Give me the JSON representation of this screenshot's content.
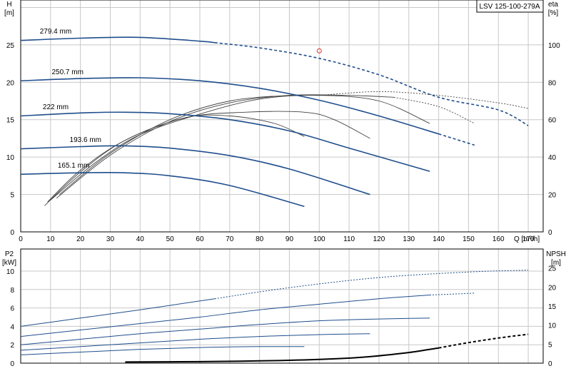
{
  "model_label": "LSV 125-100-279A",
  "chart_data": [
    {
      "type": "line",
      "panel": "head-efficiency",
      "x_unit": "Q [m³/h]",
      "xlim": [
        0,
        175
      ],
      "x_ticks": [
        0,
        10,
        20,
        30,
        40,
        50,
        60,
        70,
        80,
        90,
        100,
        110,
        120,
        130,
        140,
        150,
        160,
        170
      ],
      "left_axis": {
        "label": "H",
        "unit": "[m]",
        "lim": [
          0,
          31
        ],
        "ticks": [
          0,
          5,
          10,
          15,
          20,
          25
        ]
      },
      "right_axis": {
        "label": "eta",
        "unit": "[%]",
        "lim": [
          0,
          124
        ],
        "ticks": [
          0,
          20,
          40,
          60,
          80,
          100
        ]
      },
      "grid": true,
      "duty_point": {
        "x": 100,
        "y": 24.2
      },
      "head_curves": [
        {
          "name": "279.4 mm",
          "style": "solid",
          "points": [
            [
              0,
              25.6
            ],
            [
              20,
              25.9
            ],
            [
              40,
              26.0
            ],
            [
              60,
              25.5
            ],
            [
              65,
              25.3
            ]
          ]
        },
        {
          "name": "279.4 mm",
          "style": "dashed",
          "points": [
            [
              65,
              25.3
            ],
            [
              80,
              24.6
            ],
            [
              100,
              23.2
            ],
            [
              120,
              21.0
            ],
            [
              140,
              18.0
            ],
            [
              160,
              16.3
            ],
            [
              170,
              14.2
            ]
          ]
        },
        {
          "name": "250.7 mm",
          "style": "solid",
          "points": [
            [
              0,
              20.2
            ],
            [
              20,
              20.5
            ],
            [
              40,
              20.6
            ],
            [
              60,
              20.2
            ],
            [
              80,
              19.2
            ],
            [
              100,
              17.6
            ],
            [
              120,
              15.5
            ],
            [
              140,
              13.1
            ]
          ]
        },
        {
          "name": "250.7 mm",
          "style": "dashed",
          "points": [
            [
              140,
              13.1
            ],
            [
              152,
              11.6
            ]
          ]
        },
        {
          "name": "222 mm",
          "style": "solid",
          "points": [
            [
              0,
              15.5
            ],
            [
              20,
              15.9
            ],
            [
              35,
              16.0
            ],
            [
              50,
              15.8
            ],
            [
              70,
              15.0
            ],
            [
              90,
              13.5
            ],
            [
              110,
              11.2
            ],
            [
              137,
              8.1
            ]
          ]
        },
        {
          "name": "193.6 mm",
          "style": "solid",
          "points": [
            [
              0,
              11.1
            ],
            [
              20,
              11.4
            ],
            [
              35,
              11.5
            ],
            [
              50,
              11.2
            ],
            [
              70,
              10.2
            ],
            [
              90,
              8.4
            ],
            [
              117,
              5.0
            ]
          ]
        },
        {
          "name": "165.1 mm",
          "style": "solid",
          "points": [
            [
              0,
              7.7
            ],
            [
              20,
              7.9
            ],
            [
              35,
              7.9
            ],
            [
              50,
              7.5
            ],
            [
              70,
              6.2
            ],
            [
              95,
              3.4
            ]
          ]
        }
      ],
      "efficiency_curves": [
        {
          "name": "279.4 mm",
          "style": "solid",
          "points": [
            [
              13,
              20
            ],
            [
              30,
              42
            ],
            [
              50,
              60
            ],
            [
              70,
              70
            ],
            [
              90,
              73
            ],
            [
              100,
              73
            ]
          ]
        },
        {
          "name": "279.4 mm",
          "style": "dotted",
          "points": [
            [
              100,
              73
            ],
            [
              120,
              75
            ],
            [
              140,
              73
            ],
            [
              160,
              69
            ],
            [
              170,
              66
            ]
          ]
        },
        {
          "name": "250.7 mm",
          "style": "solid",
          "points": [
            [
              12,
              18
            ],
            [
              30,
              41
            ],
            [
              50,
              59
            ],
            [
              70,
              69
            ],
            [
              90,
              73
            ],
            [
              110,
              73
            ],
            [
              125,
              72
            ]
          ]
        },
        {
          "name": "250.7 mm",
          "style": "dotted",
          "points": [
            [
              125,
              72
            ],
            [
              140,
              67
            ],
            [
              152,
              58
            ]
          ]
        },
        {
          "name": "222 mm",
          "style": "solid",
          "points": [
            [
              10,
              17
            ],
            [
              25,
              37
            ],
            [
              40,
              52
            ],
            [
              60,
              63
            ],
            [
              80,
              71
            ],
            [
              100,
              73
            ],
            [
              120,
              70
            ],
            [
              137,
              58
            ]
          ]
        },
        {
          "name": "193.6 mm",
          "style": "solid",
          "points": [
            [
              9,
              16
            ],
            [
              20,
              33
            ],
            [
              35,
              49
            ],
            [
              55,
              61
            ],
            [
              75,
              64
            ],
            [
              95,
              64
            ],
            [
              105,
              60
            ],
            [
              117,
              50
            ]
          ]
        },
        {
          "name": "165.1 mm",
          "style": "solid",
          "points": [
            [
              8,
              14
            ],
            [
              20,
              32
            ],
            [
              35,
              49
            ],
            [
              55,
              61
            ],
            [
              70,
              62
            ],
            [
              85,
              58
            ],
            [
              95,
              51
            ]
          ]
        }
      ]
    },
    {
      "type": "line",
      "panel": "power-npsh",
      "x_unit": "Q [m³/h]",
      "xlim": [
        0,
        175
      ],
      "left_axis": {
        "label": "P2",
        "unit": "[kW]",
        "lim": [
          0,
          12.4
        ],
        "ticks": [
          0,
          2,
          4,
          6,
          8,
          10
        ]
      },
      "right_axis": {
        "label": "NPSH",
        "unit": "[m]",
        "lim": [
          0,
          30
        ],
        "ticks": [
          0,
          5,
          10,
          15,
          20,
          25
        ]
      },
      "grid": true,
      "power_curves": [
        {
          "name": "279.4 mm",
          "style": "solid",
          "points": [
            [
              0,
              4.0
            ],
            [
              20,
              4.9
            ],
            [
              40,
              5.8
            ],
            [
              65,
              7.0
            ]
          ]
        },
        {
          "name": "279.4 mm",
          "style": "dotted",
          "points": [
            [
              65,
              7.0
            ],
            [
              90,
              8.2
            ],
            [
              120,
              9.3
            ],
            [
              150,
              9.9
            ],
            [
              170,
              10.1
            ]
          ]
        },
        {
          "name": "250.7 mm",
          "style": "solid",
          "points": [
            [
              0,
              2.9
            ],
            [
              20,
              3.6
            ],
            [
              40,
              4.3
            ],
            [
              60,
              5.0
            ],
            [
              80,
              5.8
            ],
            [
              100,
              6.4
            ],
            [
              120,
              7.0
            ],
            [
              137,
              7.4
            ]
          ]
        },
        {
          "name": "250.7 mm",
          "style": "dotted",
          "points": [
            [
              137,
              7.4
            ],
            [
              152,
              7.6
            ]
          ]
        },
        {
          "name": "222 mm",
          "style": "solid",
          "points": [
            [
              0,
              2.0
            ],
            [
              20,
              2.6
            ],
            [
              40,
              3.2
            ],
            [
              60,
              3.7
            ],
            [
              80,
              4.2
            ],
            [
              100,
              4.6
            ],
            [
              120,
              4.8
            ],
            [
              137,
              4.9
            ]
          ]
        },
        {
          "name": "193.6 mm",
          "style": "solid",
          "points": [
            [
              0,
              1.4
            ],
            [
              20,
              1.8
            ],
            [
              40,
              2.2
            ],
            [
              60,
              2.6
            ],
            [
              80,
              2.9
            ],
            [
              100,
              3.1
            ],
            [
              117,
              3.2
            ]
          ]
        },
        {
          "name": "165.1 mm",
          "style": "solid",
          "points": [
            [
              0,
              0.9
            ],
            [
              20,
              1.2
            ],
            [
              40,
              1.5
            ],
            [
              60,
              1.7
            ],
            [
              80,
              1.8
            ],
            [
              95,
              1.8
            ]
          ]
        }
      ],
      "npsh_curve": [
        {
          "style": "solid",
          "points": [
            [
              35,
              0.3
            ],
            [
              60,
              0.4
            ],
            [
              80,
              0.6
            ],
            [
              100,
              1.0
            ],
            [
              115,
              1.6
            ],
            [
              130,
              2.8
            ],
            [
              140,
              4.0
            ]
          ]
        },
        {
          "style": "dashed",
          "points": [
            [
              140,
              4.0
            ],
            [
              150,
              5.4
            ],
            [
              160,
              6.6
            ],
            [
              170,
              7.6
            ]
          ]
        }
      ]
    }
  ]
}
